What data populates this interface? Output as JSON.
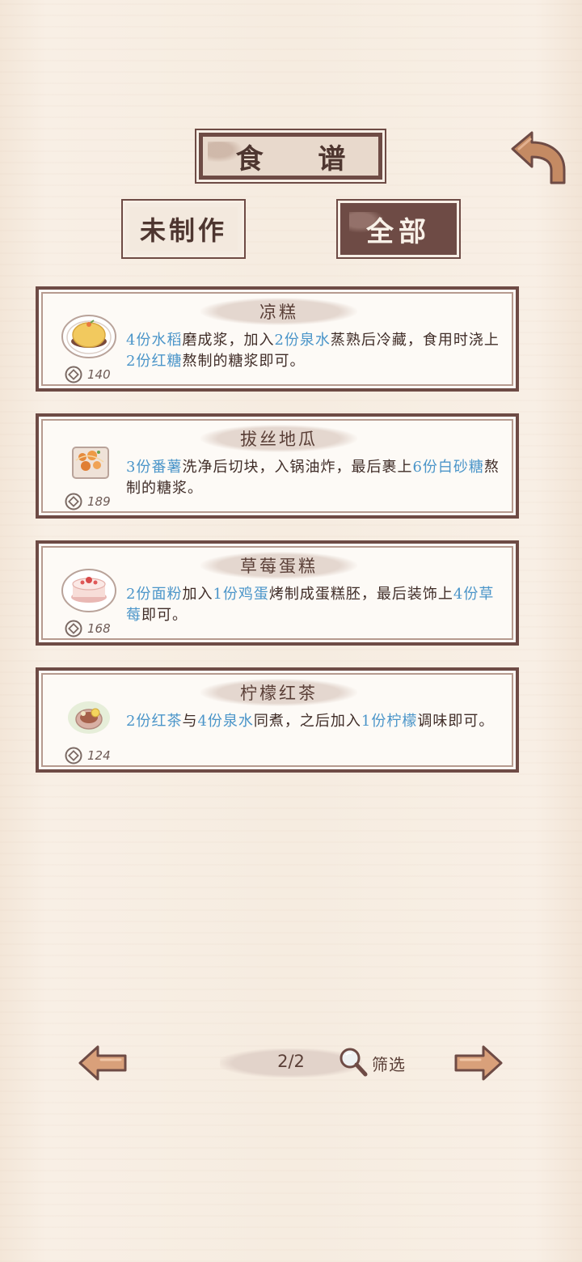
{
  "header": {
    "title": "食 谱",
    "back_icon": "back-arrow-icon",
    "filter_tabs": [
      {
        "label": "未制作",
        "active": false
      },
      {
        "label": "全部",
        "active": true
      }
    ]
  },
  "recipes": [
    {
      "name": "凉糕",
      "dish_icon": "cold-cake-dish-icon",
      "price": "140",
      "desc_parts": [
        {
          "t": "4份水稻",
          "h": true
        },
        {
          "t": "磨成浆，加入",
          "h": false
        },
        {
          "t": "2份泉水",
          "h": true
        },
        {
          "t": "蒸熟后冷藏，食用时浇上",
          "h": false
        },
        {
          "t": "2份红糖",
          "h": true
        },
        {
          "t": "熬制的糖浆即可。",
          "h": false
        }
      ]
    },
    {
      "name": "拔丝地瓜",
      "dish_icon": "candied-sweet-potato-dish-icon",
      "price": "189",
      "desc_parts": [
        {
          "t": "3份番薯",
          "h": true
        },
        {
          "t": "洗净后切块，入锅油炸，最后裹上",
          "h": false
        },
        {
          "t": "6份白砂糖",
          "h": true
        },
        {
          "t": "熬制的糖浆。",
          "h": false
        }
      ]
    },
    {
      "name": "草莓蛋糕",
      "dish_icon": "strawberry-cake-dish-icon",
      "price": "168",
      "desc_parts": [
        {
          "t": "2份面粉",
          "h": true
        },
        {
          "t": "加入",
          "h": false
        },
        {
          "t": "1份鸡蛋",
          "h": true
        },
        {
          "t": "烤制成蛋糕胚，最后装饰上",
          "h": false
        },
        {
          "t": "4份草莓",
          "h": true
        },
        {
          "t": "即可。",
          "h": false
        }
      ]
    },
    {
      "name": "柠檬红茶",
      "dish_icon": "lemon-black-tea-dish-icon",
      "price": "124",
      "desc_parts": [
        {
          "t": "2份红茶",
          "h": true
        },
        {
          "t": "与",
          "h": false
        },
        {
          "t": "4份泉水",
          "h": true
        },
        {
          "t": "同煮，之后加入",
          "h": false
        },
        {
          "t": "1份柠檬",
          "h": true
        },
        {
          "t": "调味即可。",
          "h": false
        }
      ]
    }
  ],
  "footer": {
    "page": "2/2",
    "filter_label": "筛选",
    "prev_icon": "left-arrow-icon",
    "next_icon": "right-arrow-icon",
    "filter_icon": "magnifier-icon"
  },
  "colors": {
    "frame": "#6e4b45",
    "highlight": "#4b95c9",
    "paper": "#f7eee3"
  }
}
